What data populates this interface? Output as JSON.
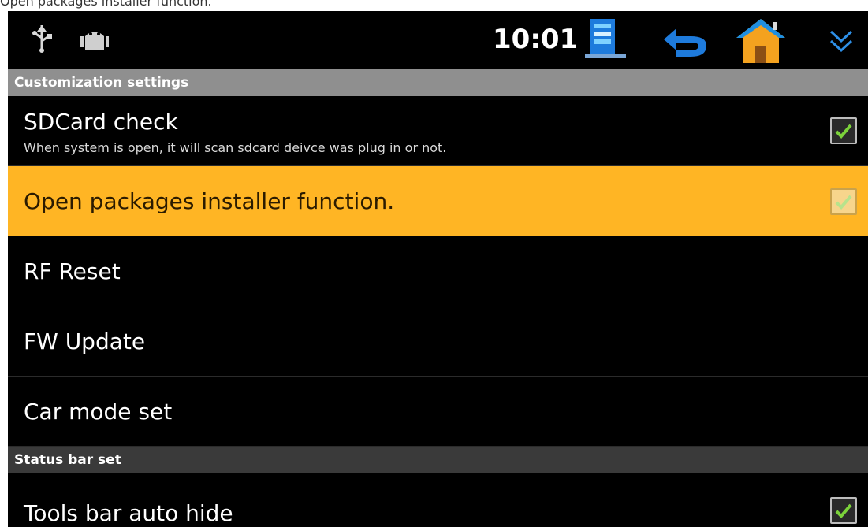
{
  "window": {
    "caption_text": "Open packages installer function."
  },
  "status_bar": {
    "time": "10:01",
    "icons": [
      "usb-icon",
      "android-icon",
      "notes-icon",
      "back-icon",
      "home-icon",
      "expand-down-icon"
    ],
    "colors": {
      "background": "#000000",
      "text": "#ffffff",
      "accent_blue": "#1e7bdc",
      "home_orange": "#f4a21f"
    }
  },
  "sections": {
    "customization": "Customization settings",
    "status_bar": "Status bar set"
  },
  "settings": [
    {
      "title": "SDCard check",
      "subtitle": "When system is open, it will scan sdcard deivce was plug in or not.",
      "checked": true
    },
    {
      "title": "Open packages installer function.",
      "subtitle": "",
      "checked": true,
      "highlighted": true
    },
    {
      "title": "RF Reset"
    },
    {
      "title": "FW Update"
    },
    {
      "title": "Car mode set"
    },
    {
      "title": "Tools bar auto hide",
      "checked": true
    }
  ],
  "colors": {
    "section_header": "#8f8f8f",
    "section_header_dark": "#3a3a3a",
    "highlight": "#ffb524",
    "check_green": "#7bd23a"
  }
}
